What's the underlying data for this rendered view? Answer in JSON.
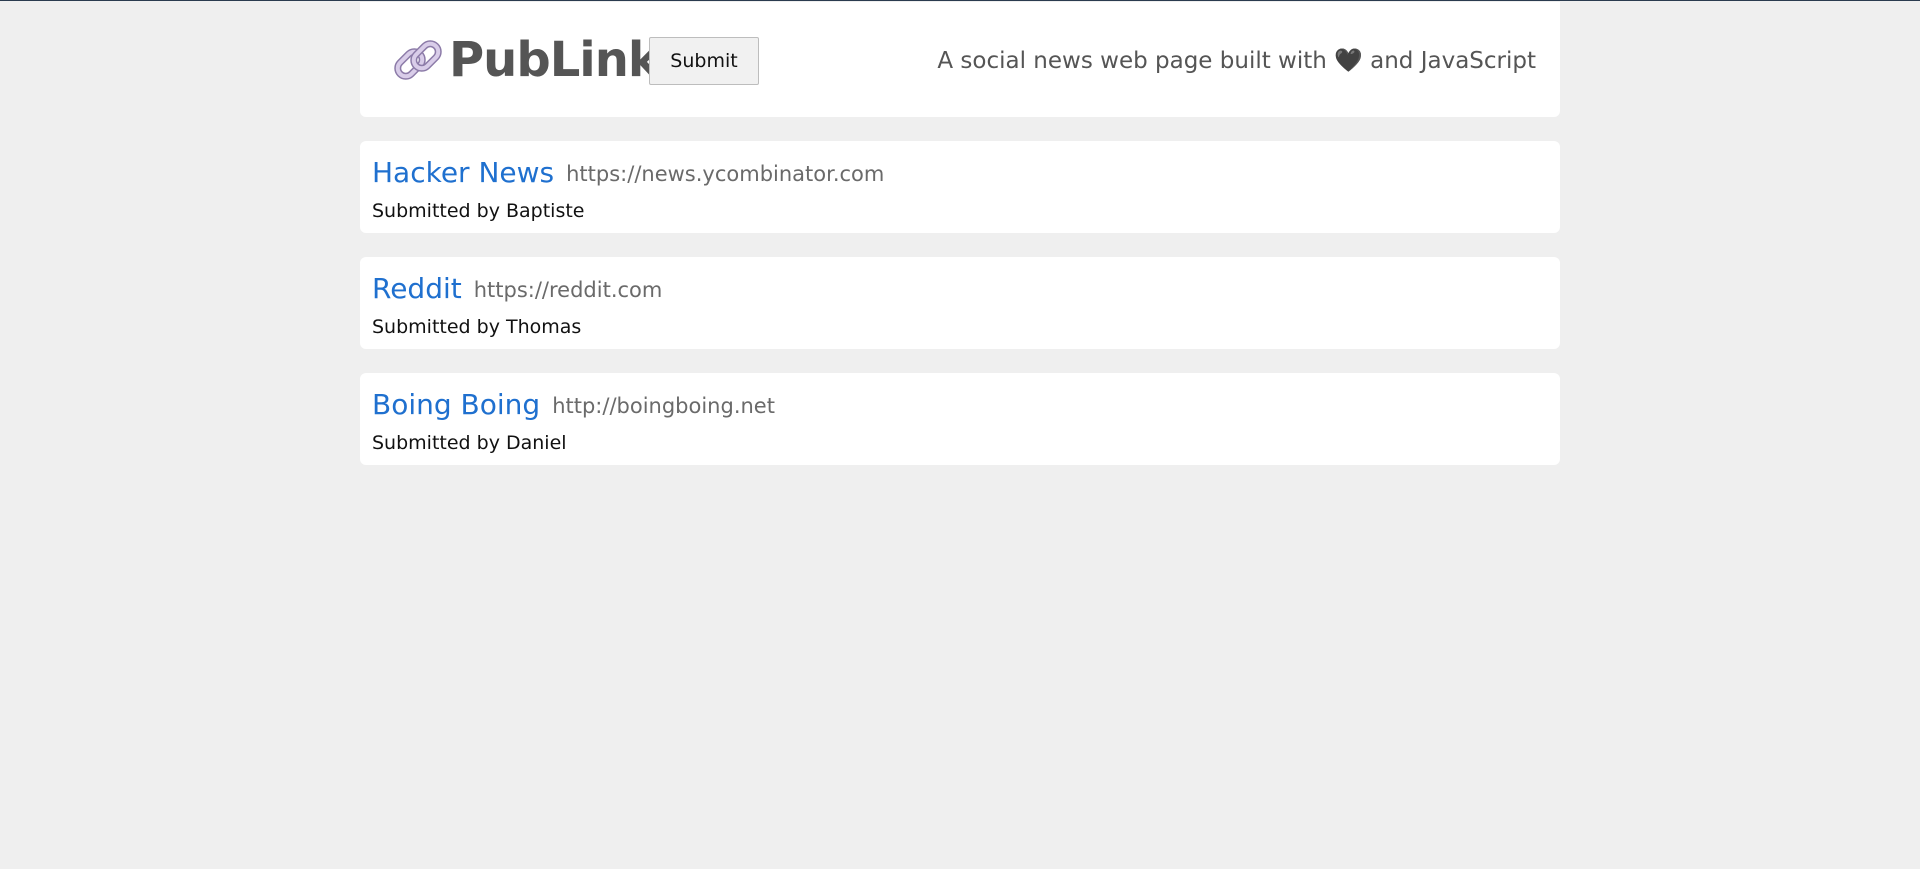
{
  "header": {
    "brand": "PubLink",
    "logo_icon": "link-icon",
    "submit_label": "Submit",
    "tagline_before": "A social news web page built with ",
    "tagline_heart": "🖤",
    "tagline_after": " and JavaScript"
  },
  "links": [
    {
      "title": "Hacker News",
      "url": "https://news.ycombinator.com",
      "author": "Submitted by Baptiste"
    },
    {
      "title": "Reddit",
      "url": "https://reddit.com",
      "author": "Submitted by Thomas"
    },
    {
      "title": "Boing Boing",
      "url": "http://boingboing.net",
      "author": "Submitted by Daniel"
    }
  ],
  "colors": {
    "background": "#efefef",
    "card": "#ffffff",
    "link": "#1f70cf",
    "muted": "#555555"
  }
}
